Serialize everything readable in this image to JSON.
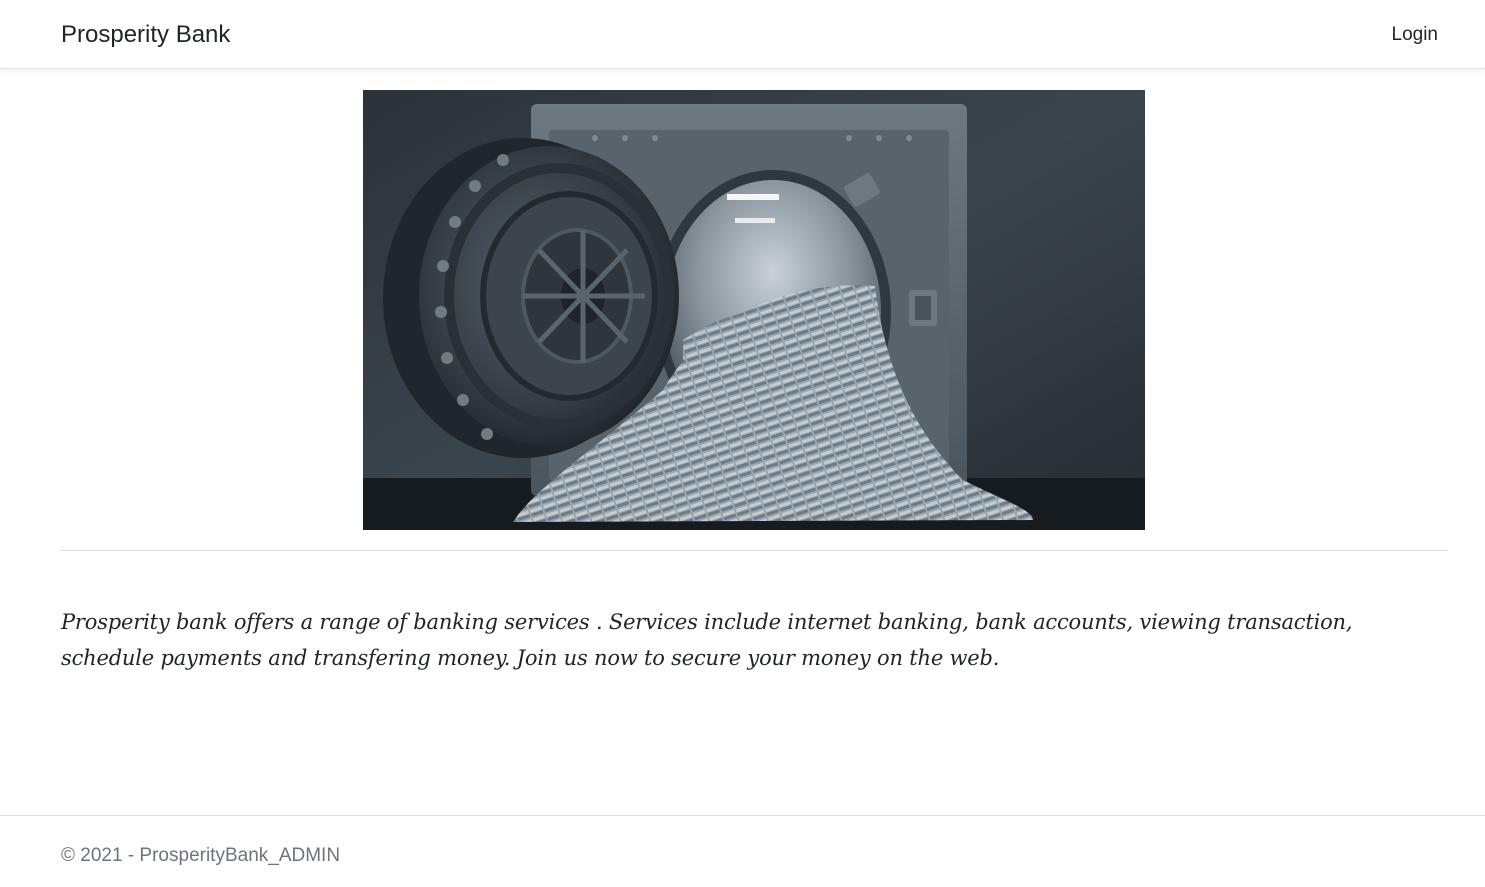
{
  "navbar": {
    "brand": "Prosperity Bank",
    "login_label": "Login"
  },
  "hero": {
    "alt": "Open bank vault door with stacks of money spilling out",
    "icon": "bank-vault-image"
  },
  "content": {
    "intro": "Prosperity bank offers a range of banking services . Services include internet banking, bank accounts, viewing transaction, schedule payments and transfering money. Join us now to secure your money on the web."
  },
  "footer": {
    "copyright": "© 2021 - ProsperityBank_ADMIN"
  },
  "colors": {
    "text": "#212529",
    "muted": "#6c757d",
    "border": "#dee2e6",
    "vault_dark": "#1b2026",
    "vault_steel": "#5f6b75"
  }
}
